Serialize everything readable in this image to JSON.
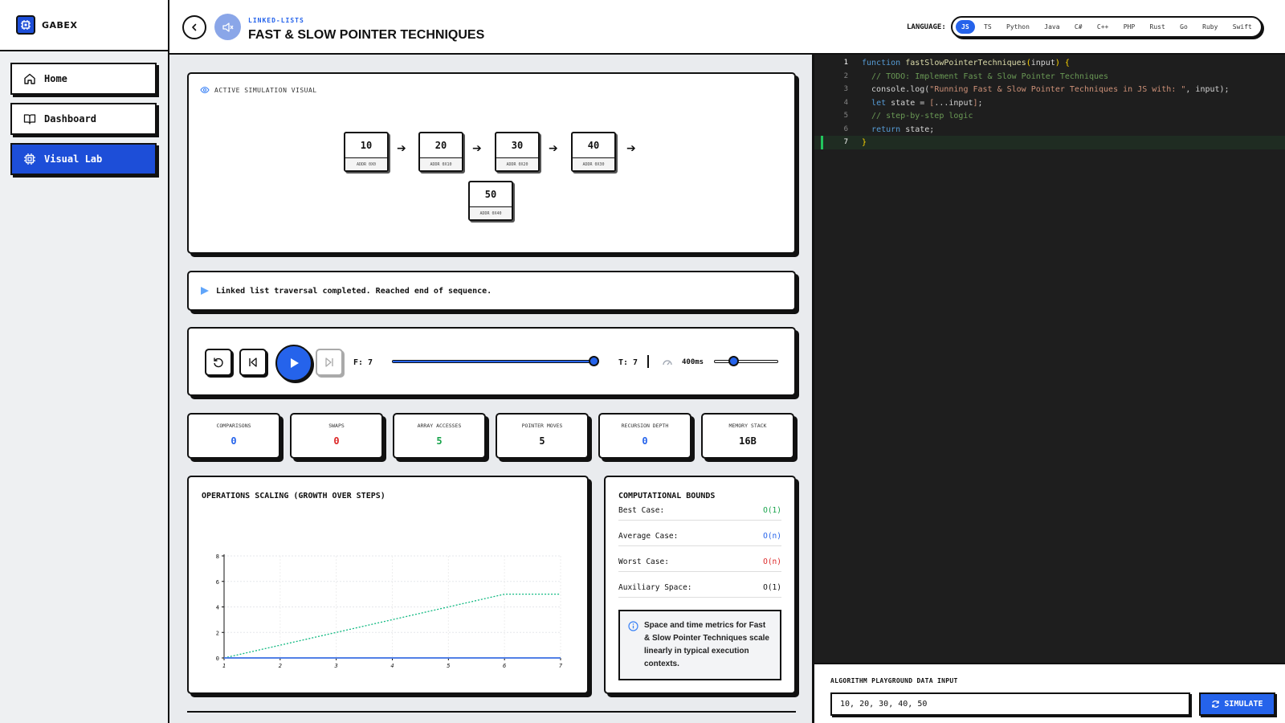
{
  "brand": {
    "name": "GABEX"
  },
  "sidebar": {
    "items": [
      {
        "label": "Home",
        "icon": "home-icon"
      },
      {
        "label": "Dashboard",
        "icon": "book-icon"
      },
      {
        "label": "Visual Lab",
        "icon": "chip-icon",
        "active": true
      }
    ]
  },
  "header": {
    "breadcrumb": "LINKED-LISTS",
    "title": "FAST & SLOW POINTER TECHNIQUES",
    "language_label": "LANGUAGE:",
    "languages": [
      "JS",
      "TS",
      "Python",
      "Java",
      "C#",
      "C++",
      "PHP",
      "Rust",
      "Go",
      "Ruby",
      "Swift"
    ],
    "active_language": "JS"
  },
  "visual": {
    "label": "ACTIVE SIMULATION VISUAL",
    "nodes": [
      {
        "value": "10",
        "addr": "ADDR 0X0"
      },
      {
        "value": "20",
        "addr": "ADDR 0X10"
      },
      {
        "value": "30",
        "addr": "ADDR 0X20"
      },
      {
        "value": "40",
        "addr": "ADDR 0X30"
      },
      {
        "value": "50",
        "addr": "ADDR 0X40"
      }
    ]
  },
  "status": {
    "message": "Linked list traversal completed. Reached end of sequence."
  },
  "controls": {
    "frame_label": "F: 7",
    "total_label": "T: 7",
    "speed_label": "400ms",
    "progress": 1.0,
    "speed_level": 0.25
  },
  "metrics": [
    {
      "label": "COMPARISONS",
      "value": "0",
      "color": "#2563eb"
    },
    {
      "label": "SWAPS",
      "value": "0",
      "color": "#dc2626"
    },
    {
      "label": "ARRAY ACCESSES",
      "value": "5",
      "color": "#16a34a"
    },
    {
      "label": "POINTER MOVES",
      "value": "5",
      "color": "#111111"
    },
    {
      "label": "RECURSION DEPTH",
      "value": "0",
      "color": "#2563eb"
    },
    {
      "label": "MEMORY STACK",
      "value": "16B",
      "color": "#111111"
    }
  ],
  "chart_data": {
    "type": "line",
    "title": "OPERATIONS SCALING (GROWTH OVER STEPS)",
    "x": [
      1,
      2,
      3,
      4,
      5,
      6,
      7
    ],
    "xticks": [
      "1",
      "2",
      "3",
      "4",
      "5",
      "6",
      "7"
    ],
    "yticks": [
      "0",
      "2",
      "4",
      "6",
      "8"
    ],
    "ylim": [
      0,
      8
    ],
    "series": [
      {
        "values": [
          0,
          1,
          2,
          3,
          4,
          5,
          5
        ],
        "color": "#10b981",
        "style": "dotted"
      },
      {
        "values": [
          0,
          0,
          0,
          0,
          0,
          0,
          0
        ],
        "color": "#ef4444",
        "style": "solid"
      },
      {
        "values": [
          0,
          0,
          0,
          0,
          0,
          0,
          0
        ],
        "color": "#3b82f6",
        "style": "solid"
      }
    ],
    "grid": true
  },
  "bounds": {
    "title": "COMPUTATIONAL BOUNDS",
    "rows": [
      {
        "label": "Best Case:",
        "value": "O(1)",
        "color": "#16a34a"
      },
      {
        "label": "Average Case:",
        "value": "O(n)",
        "color": "#2563eb"
      },
      {
        "label": "Worst Case:",
        "value": "O(n)",
        "color": "#dc2626"
      },
      {
        "label": "Auxiliary Space:",
        "value": "O(1)",
        "color": "#111111"
      }
    ],
    "note": "Space and time metrics for Fast & Slow Pointer Techniques scale linearly in typical execution contexts."
  },
  "editor": {
    "lines": [
      "function fastSlowPointerTechniques(input) {",
      "  // TODO: Implement Fast & Slow Pointer Techniques",
      "  console.log(\"Running Fast & Slow Pointer Techniques in JS with: \", input);",
      "  let state = [...input];",
      "  // step-by-step logic",
      "  return state;",
      "}"
    ],
    "line_numbers": [
      "1",
      "2",
      "3",
      "4",
      "5",
      "6",
      "7"
    ]
  },
  "input": {
    "label": "ALGORITHM PLAYGROUND DATA INPUT",
    "value": "10, 20, 30, 40, 50",
    "button": "SIMULATE"
  }
}
